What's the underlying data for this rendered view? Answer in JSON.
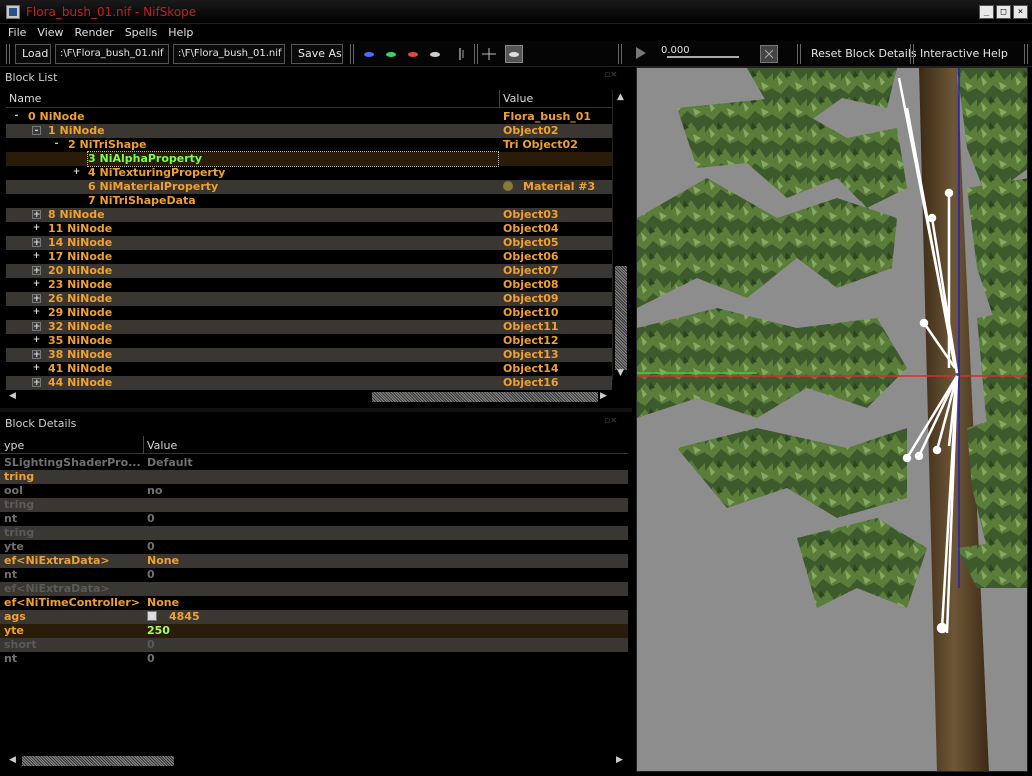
{
  "window": {
    "title": "Flora_bush_01.nif - NifSkope",
    "min": "_",
    "max": "□",
    "close": "×"
  },
  "menu": [
    "File",
    "View",
    "Render",
    "Spells",
    "Help"
  ],
  "toolbar": {
    "load_label": "Load",
    "path1": ":\\F\\Flora_bush_01.nif",
    "path2": ":\\F\\Flora_bush_01.nif",
    "save_as_label": "Save As",
    "time_value": "0.000",
    "reset_label": "Reset Block Details",
    "help_label": "Interactive Help"
  },
  "block_list": {
    "title": "Block List",
    "col_name": "Name",
    "col_value": "Value",
    "rows": [
      {
        "indent": 0,
        "expander": "-",
        "box": false,
        "name": "0 NiNode",
        "value": "Flora_bush_01",
        "alt": false
      },
      {
        "indent": 1,
        "expander": "-",
        "box": true,
        "name": "1 NiNode",
        "value": "Object02",
        "alt": true
      },
      {
        "indent": 2,
        "expander": "-",
        "box": false,
        "name": "2 NiTriShape",
        "value": "Tri Object02",
        "alt": false
      },
      {
        "indent": 3,
        "expander": "",
        "box": false,
        "name": "3 NiAlphaProperty",
        "value": "",
        "alt": true,
        "selected": true
      },
      {
        "indent": 3,
        "expander": "+",
        "box": false,
        "name": "4 NiTexturingProperty",
        "value": "",
        "alt": false
      },
      {
        "indent": 3,
        "expander": "",
        "box": false,
        "name": "6 NiMaterialProperty",
        "value": "Material #3",
        "alt": true,
        "icon": true
      },
      {
        "indent": 3,
        "expander": "",
        "box": false,
        "name": "7 NiTriShapeData",
        "value": "",
        "alt": false
      },
      {
        "indent": 1,
        "expander": "+",
        "box": true,
        "name": "8 NiNode",
        "value": "Object03",
        "alt": true
      },
      {
        "indent": 1,
        "expander": "+",
        "box": false,
        "name": "11 NiNode",
        "value": "Object04",
        "alt": false
      },
      {
        "indent": 1,
        "expander": "+",
        "box": true,
        "name": "14 NiNode",
        "value": "Object05",
        "alt": true
      },
      {
        "indent": 1,
        "expander": "+",
        "box": false,
        "name": "17 NiNode",
        "value": "Object06",
        "alt": false
      },
      {
        "indent": 1,
        "expander": "+",
        "box": true,
        "name": "20 NiNode",
        "value": "Object07",
        "alt": true
      },
      {
        "indent": 1,
        "expander": "+",
        "box": false,
        "name": "23 NiNode",
        "value": "Object08",
        "alt": false
      },
      {
        "indent": 1,
        "expander": "+",
        "box": true,
        "name": "26 NiNode",
        "value": "Object09",
        "alt": true
      },
      {
        "indent": 1,
        "expander": "+",
        "box": false,
        "name": "29 NiNode",
        "value": "Object10",
        "alt": false
      },
      {
        "indent": 1,
        "expander": "+",
        "box": true,
        "name": "32 NiNode",
        "value": "Object11",
        "alt": true
      },
      {
        "indent": 1,
        "expander": "+",
        "box": false,
        "name": "35 NiNode",
        "value": "Object12",
        "alt": false
      },
      {
        "indent": 1,
        "expander": "+",
        "box": true,
        "name": "38 NiNode",
        "value": "Object13",
        "alt": true
      },
      {
        "indent": 1,
        "expander": "+",
        "box": false,
        "name": "41 NiNode",
        "value": "Object14",
        "alt": false
      },
      {
        "indent": 1,
        "expander": "+",
        "box": true,
        "name": "44 NiNode",
        "value": "Object16",
        "alt": true
      }
    ]
  },
  "block_details": {
    "title": "Block Details",
    "col_name": "ype",
    "col_value": "Value",
    "rows": [
      {
        "name": "SLightingShaderPro...",
        "value": "Default",
        "nc": "c-gr",
        "vc": "c-gr",
        "alt": false
      },
      {
        "name": "tring",
        "value": "",
        "nc": "c-or",
        "vc": "c-or",
        "alt": true
      },
      {
        "name": "ool",
        "value": "no",
        "nc": "c-gr",
        "vc": "c-gr",
        "alt": false
      },
      {
        "name": "tring",
        "value": "",
        "nc": "c-dk",
        "vc": "c-dk",
        "alt": true
      },
      {
        "name": "nt",
        "value": "0",
        "nc": "c-gr",
        "vc": "c-gr",
        "alt": false
      },
      {
        "name": "tring",
        "value": "",
        "nc": "c-dk",
        "vc": "c-dk",
        "alt": true
      },
      {
        "name": "yte",
        "value": "0",
        "nc": "c-gr",
        "vc": "c-gr",
        "alt": false
      },
      {
        "name": "ef<NiExtraData>",
        "value": "None",
        "nc": "c-or",
        "vc": "c-or",
        "alt": true
      },
      {
        "name": "nt",
        "value": "0",
        "nc": "c-gr",
        "vc": "c-gr",
        "alt": false
      },
      {
        "name": "ef<NiExtraData>",
        "value": "",
        "nc": "c-dk",
        "vc": "c-dk",
        "alt": true
      },
      {
        "name": "ef<NiTimeController>",
        "value": "None",
        "nc": "c-or",
        "vc": "c-or",
        "alt": false
      },
      {
        "name": "ags",
        "value": "4845",
        "nc": "c-or",
        "vc": "c-or",
        "alt": true,
        "flag": true
      },
      {
        "name": "yte",
        "value": "250",
        "nc": "c-or",
        "vc": "c-hi",
        "alt": false,
        "hl": true
      },
      {
        "name": "short",
        "value": "0",
        "nc": "c-dk",
        "vc": "c-dk",
        "alt": true
      },
      {
        "name": "nt",
        "value": "0",
        "nc": "c-gr",
        "vc": "c-gr",
        "alt": false
      }
    ]
  },
  "colors": {
    "accent": "#f0a030",
    "selected": "#7cff4c",
    "title": "#c02020"
  }
}
